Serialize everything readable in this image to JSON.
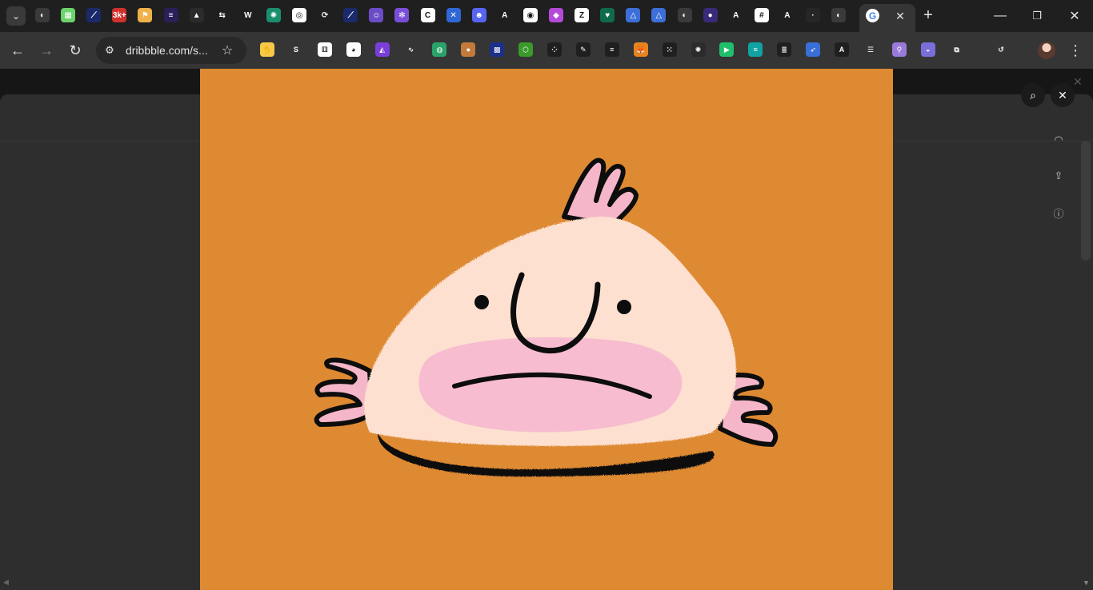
{
  "browser": {
    "omnibox": {
      "url": "dribbble.com/s..."
    },
    "tab_close_glyph": "✕",
    "new_tab_glyph": "+",
    "window_controls": {
      "minimize": "—",
      "restore": "❐",
      "close": "✕"
    },
    "favicons": [
      {
        "name": "ext-tab-favicon",
        "bg": "#3a3a3a",
        "glyph": "◐"
      },
      {
        "name": "qr-favicon",
        "bg": "#6bd36b",
        "glyph": "▦"
      },
      {
        "name": "blue-swoosh-favicon",
        "bg": "#1b2a6b",
        "glyph": "⟋"
      },
      {
        "name": "red-badge-favicon",
        "bg": "#d0312d",
        "glyph": "3k+"
      },
      {
        "name": "yellow-flag-favicon",
        "bg": "#f0b14a",
        "glyph": "⚑"
      },
      {
        "name": "purple-lines-favicon",
        "bg": "#2a1f58",
        "glyph": "≡"
      },
      {
        "name": "red-triangle-favicon",
        "bg": "#2b2b2b",
        "glyph": "▲"
      },
      {
        "name": "arrows-favicon",
        "bg": "#1f1f1f",
        "glyph": "⇆"
      },
      {
        "name": "w-logo-favicon",
        "bg": "#1f1f1f",
        "glyph": "W"
      },
      {
        "name": "openai-favicon",
        "bg": "#1a8f6e",
        "glyph": "✺"
      },
      {
        "name": "circle-favicon",
        "bg": "#ffffff",
        "glyph": "◎"
      },
      {
        "name": "teal-favicon",
        "bg": "#1f1f1f",
        "glyph": "⟳"
      },
      {
        "name": "blue-swoosh-favicon-2",
        "bg": "#1b2a6b",
        "glyph": "⟋"
      },
      {
        "name": "smiley-favicon",
        "bg": "#6b4cc7",
        "glyph": "☺"
      },
      {
        "name": "purple-flower-favicon",
        "bg": "#7a4fd8",
        "glyph": "✻"
      },
      {
        "name": "c-logo-favicon",
        "bg": "#ffffff",
        "glyph": "C"
      },
      {
        "name": "cross-favicon",
        "bg": "#2f68d6",
        "glyph": "✕"
      },
      {
        "name": "discord-favicon",
        "bg": "#5865f2",
        "glyph": "☻"
      },
      {
        "name": "a-logo-favicon",
        "bg": "#1f1f1f",
        "glyph": "A"
      },
      {
        "name": "shield-favicon",
        "bg": "#ffffff",
        "glyph": "◉"
      },
      {
        "name": "gem-favicon",
        "bg": "#b54ad8",
        "glyph": "◆"
      },
      {
        "name": "z-logo-favicon",
        "bg": "#ffffff",
        "glyph": "Z"
      },
      {
        "name": "green-heart-favicon",
        "bg": "#0f6b4a",
        "glyph": "♥"
      },
      {
        "name": "blue-triangle-favicon",
        "bg": "#3c6fd8",
        "glyph": "△"
      },
      {
        "name": "blue-triangle-favicon-2",
        "bg": "#3c6fd8",
        "glyph": "△"
      },
      {
        "name": "globe-favicon",
        "bg": "#3a3a3a",
        "glyph": "◐"
      },
      {
        "name": "purple-orb-favicon",
        "bg": "#3a2a7a",
        "glyph": "●"
      },
      {
        "name": "a-dark-favicon",
        "bg": "#1f1f1f",
        "glyph": "A"
      },
      {
        "name": "grid-favicon",
        "bg": "#ffffff",
        "glyph": "#"
      },
      {
        "name": "a-dark-favicon-2",
        "bg": "#1f1f1f",
        "glyph": "A"
      },
      {
        "name": "dark-favicon",
        "bg": "#262626",
        "glyph": "·"
      },
      {
        "name": "globe-favicon-2",
        "bg": "#3a3a3a",
        "glyph": "◐"
      }
    ],
    "extensions": [
      {
        "name": "hand-extension-icon",
        "bg": "#f7c948",
        "glyph": "✋"
      },
      {
        "name": "s-extension-icon",
        "bg": "#353535",
        "glyph": "S"
      },
      {
        "name": "dice-extension-icon",
        "bg": "#ffffff",
        "glyph": "⚅"
      },
      {
        "name": "panda-extension-icon",
        "bg": "#ffffff",
        "glyph": "◕"
      },
      {
        "name": "prism-extension-icon",
        "bg": "#7a3fd8",
        "glyph": "◭"
      },
      {
        "name": "wave-extension-icon",
        "bg": "#353535",
        "glyph": "∿"
      },
      {
        "name": "green-globe-extension-icon",
        "bg": "#2aa36b",
        "glyph": "◍"
      },
      {
        "name": "orange-ball-extension-icon",
        "bg": "#c47a3a",
        "glyph": "●"
      },
      {
        "name": "blue-grid-extension-icon",
        "bg": "#1c2f8a",
        "glyph": "▩"
      },
      {
        "name": "green-hex-extension-icon",
        "bg": "#3a9a2a",
        "glyph": "⬡"
      },
      {
        "name": "dots-extension-icon",
        "bg": "#1f1f1f",
        "glyph": "⁘"
      },
      {
        "name": "pen-extension-icon",
        "bg": "#1f1f1f",
        "glyph": "✎"
      },
      {
        "name": "lines-extension-icon",
        "bg": "#1f1f1f",
        "glyph": "≡"
      },
      {
        "name": "metamask-extension-icon",
        "bg": "#e8831d",
        "glyph": "🦊"
      },
      {
        "name": "pattern-extension-icon",
        "bg": "#1f1f1f",
        "glyph": "⁙"
      },
      {
        "name": "octopus-extension-icon",
        "bg": "#2b2b2b",
        "glyph": "✺"
      },
      {
        "name": "green-play-extension-icon",
        "bg": "#1fbf6b",
        "glyph": "▶"
      },
      {
        "name": "teal-wave-extension-icon",
        "bg": "#11a3a3",
        "glyph": "≈"
      },
      {
        "name": "stack-extension-icon",
        "bg": "#1f1f1f",
        "glyph": "≣"
      },
      {
        "name": "bird-extension-icon",
        "bg": "#3a6fd8",
        "glyph": "➶"
      },
      {
        "name": "a-extension-icon",
        "bg": "#1f1f1f",
        "glyph": "A"
      },
      {
        "name": "sliders-extension-icon",
        "bg": "#353535",
        "glyph": "☰"
      },
      {
        "name": "pin-extension-icon",
        "bg": "#9a7ad8",
        "glyph": "⚲"
      },
      {
        "name": "ghost-extension-icon",
        "bg": "#7a6fd8",
        "glyph": "◒"
      },
      {
        "name": "puzzle-extension-icon",
        "bg": "#353535",
        "glyph": "⧉"
      },
      {
        "name": "history-extension-icon",
        "bg": "#353535",
        "glyph": "↺"
      }
    ]
  },
  "lightbox": {
    "zoom_glyph": "⌕",
    "close_glyph": "✕",
    "image_bg": "#de8a33"
  },
  "side_actions": {
    "comment": "◠",
    "share": "⇪",
    "info": "ⓘ"
  }
}
